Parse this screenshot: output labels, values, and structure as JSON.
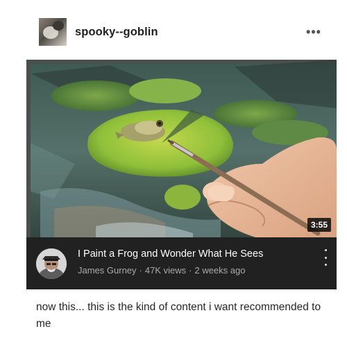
{
  "post": {
    "username": "spooky--goblin",
    "more_label": "•••",
    "caption": "now this... this is the kind of content i want recommended to me"
  },
  "video": {
    "duration": "3:55",
    "title": "I Paint a Frog and Wonder What He Sees",
    "channel": "James Gurney",
    "views": "47K views",
    "age": "2 weeks ago",
    "separator": "·"
  },
  "icons": {
    "post_avatar": "blog-avatar-icon",
    "more": "more-options-icon",
    "channel_avatar": "channel-avatar-icon",
    "kebab": "vertical-dots-menu-icon"
  },
  "colors": {
    "card_background": "#212121",
    "meta_text": "#aaaaaa",
    "username_text": "#222222"
  }
}
